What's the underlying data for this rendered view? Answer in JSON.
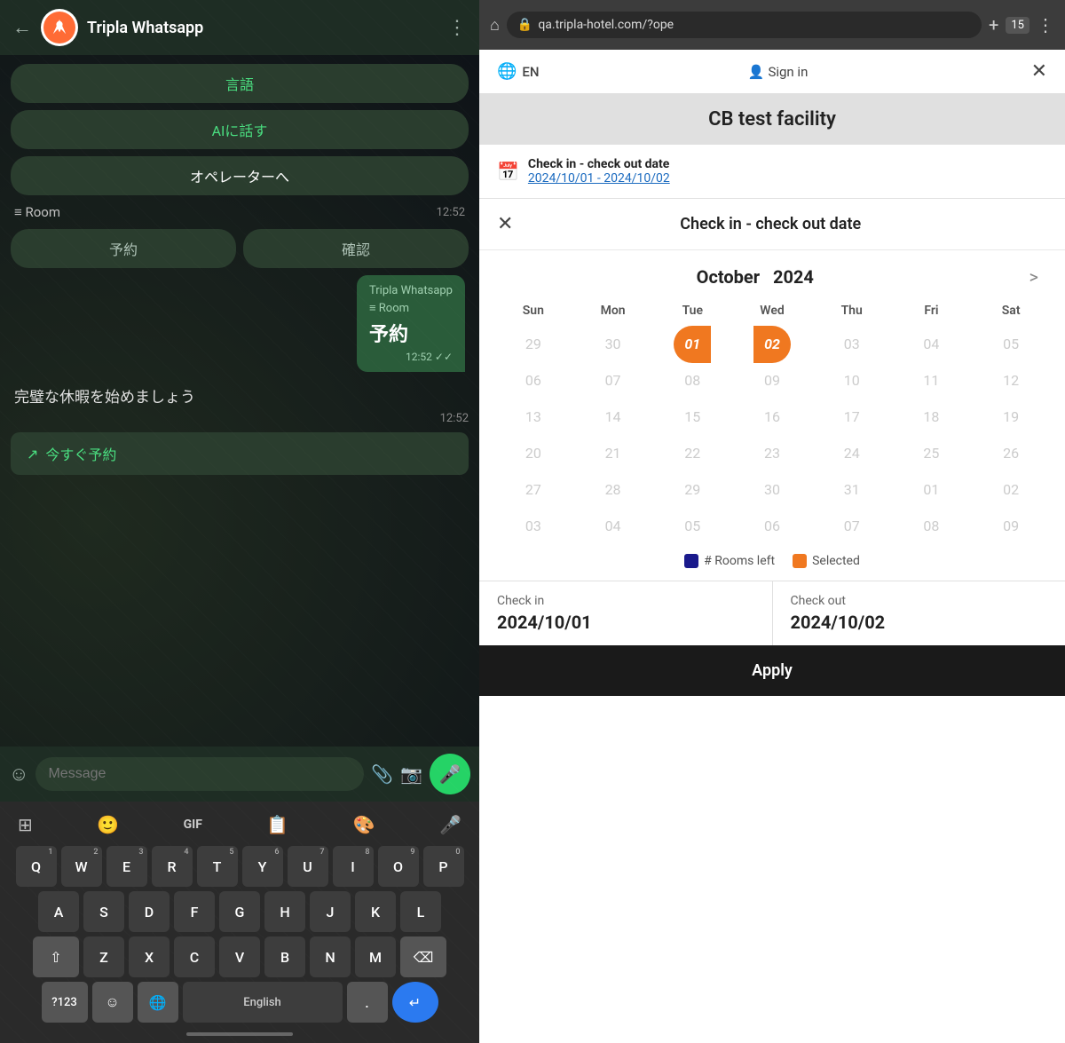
{
  "left_panel": {
    "header": {
      "title": "Tripla Whatsapp",
      "back_icon": "←",
      "more_icon": "⋮"
    },
    "buttons": {
      "language": "言語",
      "ai_talk": "AIに話す",
      "operator": "オペレーターへ",
      "reservation": "予約",
      "confirm": "確認",
      "book_now_icon": "↗",
      "book_now": "今すぐ予約"
    },
    "room_section": {
      "label": "≡ Room",
      "time": "12:52"
    },
    "tripla_bubble": {
      "sender": "Tripla Whatsapp",
      "room": "≡ Room",
      "booking": "予約",
      "time": "12:52 ✓✓"
    },
    "perfect_vacation": {
      "text": "完璧な休暇を始めましょう",
      "time": "12:52"
    },
    "input": {
      "placeholder": "Message"
    },
    "keyboard": {
      "toolbar_icons": [
        "grid",
        "sticker",
        "GIF",
        "clipboard",
        "palette",
        "mic"
      ],
      "rows": [
        [
          "Q",
          "W",
          "E",
          "R",
          "T",
          "Y",
          "U",
          "I",
          "O",
          "P"
        ],
        [
          "A",
          "S",
          "D",
          "F",
          "G",
          "H",
          "J",
          "K",
          "L"
        ],
        [
          "Z",
          "X",
          "C",
          "V",
          "B",
          "N",
          "M"
        ],
        [
          "?123",
          "emoji",
          "globe",
          "English",
          ".",
          "enter"
        ]
      ],
      "nums": [
        "1",
        "2",
        "3",
        "4",
        "5",
        "6",
        "7",
        "8",
        "9",
        "0"
      ],
      "lang": "English"
    }
  },
  "right_panel": {
    "browser": {
      "url": "qa.tripla-hotel.com/?ope",
      "tabs_count": "15",
      "home_icon": "⌂",
      "plus_icon": "+",
      "more_icon": "⋮"
    },
    "hotel": {
      "title": "CB test facility",
      "lang": "EN",
      "sign_in": "Sign in",
      "close_icon": "✕",
      "globe_icon": "🌐",
      "person_icon": "👤"
    },
    "date_section": {
      "label": "Check in - check out date",
      "value": "2024/10/01 - 2024/10/02",
      "calendar_icon": "📅"
    },
    "modal": {
      "close_icon": "✕",
      "title": "Check in - check out date",
      "month": "October",
      "year": "2024",
      "nav_right": ">",
      "day_headers": [
        "Sun",
        "Mon",
        "Tue",
        "Wed",
        "Thu",
        "Fri",
        "Sat"
      ],
      "weeks": [
        [
          "29",
          "30",
          "01",
          "02",
          "03",
          "04",
          "05"
        ],
        [
          "06",
          "07",
          "08",
          "09",
          "10",
          "11",
          "12"
        ],
        [
          "13",
          "14",
          "15",
          "16",
          "17",
          "18",
          "19"
        ],
        [
          "20",
          "21",
          "22",
          "23",
          "24",
          "25",
          "26"
        ],
        [
          "27",
          "28",
          "29",
          "30",
          "31",
          "01",
          "02"
        ],
        [
          "03",
          "04",
          "05",
          "06",
          "07",
          "08",
          "09"
        ]
      ],
      "selected_start": "01",
      "selected_end": "02",
      "legend": {
        "rooms_label": "# Rooms left",
        "selected_label": "Selected"
      },
      "checkin_label": "Check in",
      "checkin_date": "2024/10/01",
      "checkout_label": "Check out",
      "checkout_date": "2024/10/02",
      "apply_label": "Apply"
    }
  }
}
